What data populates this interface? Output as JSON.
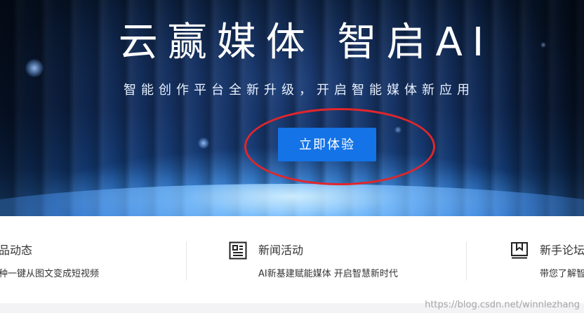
{
  "hero": {
    "title": "云赢媒体 智启AI",
    "subtitle": "智能创作平台全新升级，开启智能媒体新应用",
    "cta_label": "立即体验"
  },
  "features": [
    {
      "title": "品动态",
      "desc": "种一键从图文变成短视频",
      "icon": "product-icon"
    },
    {
      "title": "新闻活动",
      "desc": "AI新基建赋能媒体 开启智慧新时代",
      "icon": "news-icon"
    },
    {
      "title": "新手论坛",
      "desc": "带您了解智",
      "icon": "book-icon"
    }
  ],
  "watermark": "https://blog.csdn.net/winnlezhang",
  "colors": {
    "cta": "#1473e6",
    "annotation": "#e0262b",
    "text_dark": "#333333"
  }
}
